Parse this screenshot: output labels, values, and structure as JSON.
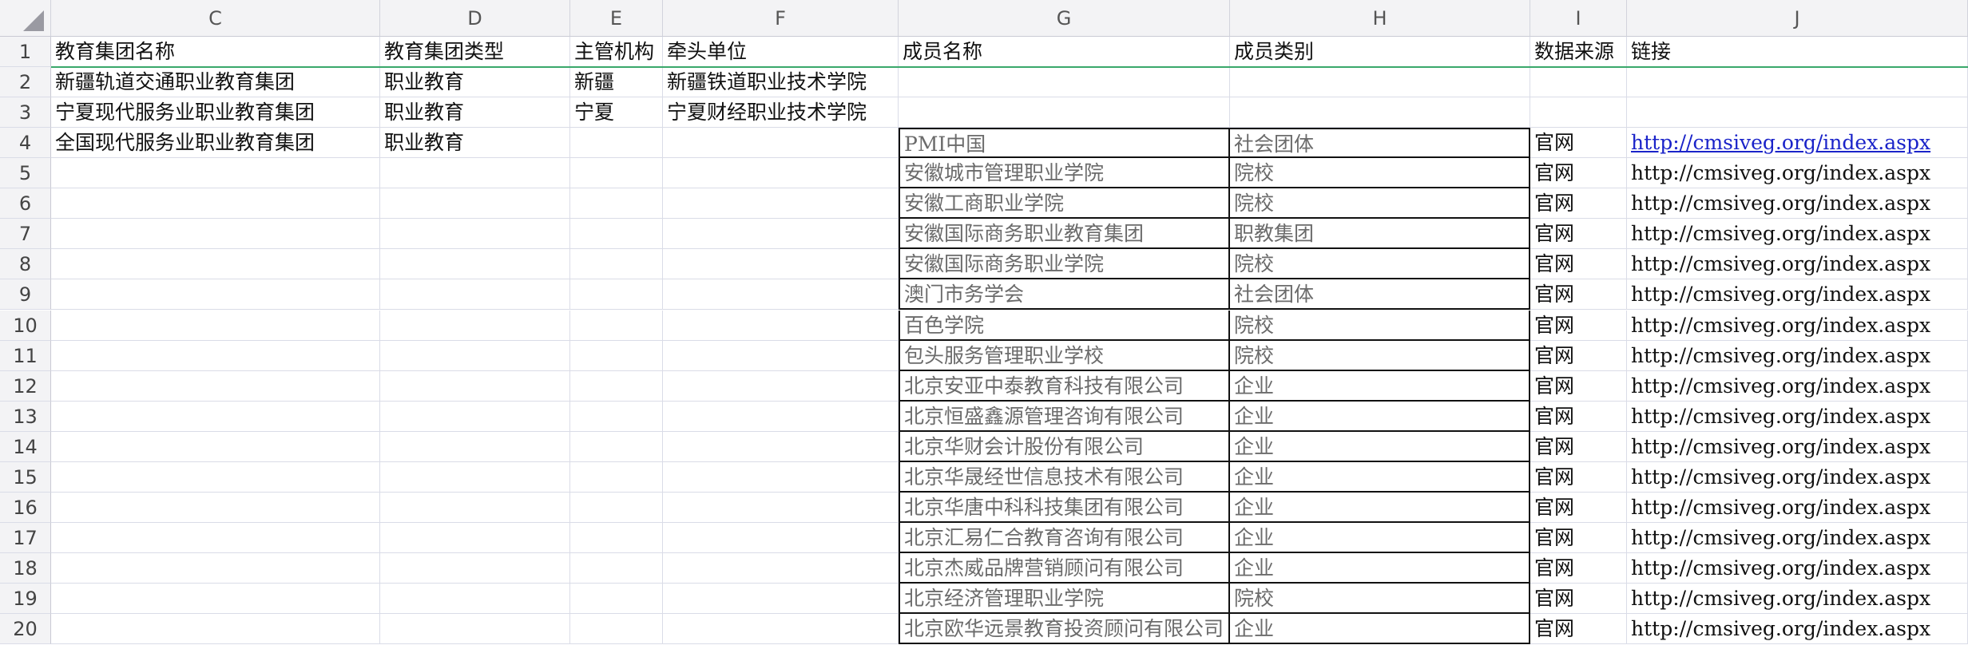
{
  "columns": [
    "C",
    "D",
    "E",
    "F",
    "G",
    "H",
    "I",
    "J"
  ],
  "rows": [
    {
      "num": "1",
      "cells": [
        "教育集团名称",
        "教育集团类型",
        "主管机构",
        "牵头单位",
        "成员名称",
        "成员类别",
        "数据来源",
        "链接"
      ]
    },
    {
      "num": "2",
      "cells": [
        "新疆轨道交通职业教育集团",
        "职业教育",
        "新疆",
        "新疆铁道职业技术学院",
        "",
        "",
        "",
        ""
      ]
    },
    {
      "num": "3",
      "cells": [
        "宁夏现代服务业职业教育集团",
        "职业教育",
        "宁夏",
        "宁夏财经职业技术学院",
        "",
        "",
        "",
        ""
      ]
    },
    {
      "num": "4",
      "cells": [
        "全国现代服务业职业教育集团",
        "职业教育",
        "",
        "",
        "PMI中国",
        "社会团体",
        "官网",
        "http://cmsiveg.org/index.aspx"
      ]
    },
    {
      "num": "5",
      "cells": [
        "",
        "",
        "",
        "",
        "安徽城市管理职业学院",
        "院校",
        "官网",
        "http://cmsiveg.org/index.aspx"
      ]
    },
    {
      "num": "6",
      "cells": [
        "",
        "",
        "",
        "",
        "安徽工商职业学院",
        "院校",
        "官网",
        "http://cmsiveg.org/index.aspx"
      ]
    },
    {
      "num": "7",
      "cells": [
        "",
        "",
        "",
        "",
        "安徽国际商务职业教育集团",
        "职教集团",
        "官网",
        "http://cmsiveg.org/index.aspx"
      ]
    },
    {
      "num": "8",
      "cells": [
        "",
        "",
        "",
        "",
        "安徽国际商务职业学院",
        "院校",
        "官网",
        "http://cmsiveg.org/index.aspx"
      ]
    },
    {
      "num": "9",
      "cells": [
        "",
        "",
        "",
        "",
        "澳门市务学会",
        "社会团体",
        "官网",
        "http://cmsiveg.org/index.aspx"
      ]
    },
    {
      "num": "10",
      "cells": [
        "",
        "",
        "",
        "",
        "百色学院",
        "院校",
        "官网",
        "http://cmsiveg.org/index.aspx"
      ]
    },
    {
      "num": "11",
      "cells": [
        "",
        "",
        "",
        "",
        "包头服务管理职业学校",
        "院校",
        "官网",
        "http://cmsiveg.org/index.aspx"
      ]
    },
    {
      "num": "12",
      "cells": [
        "",
        "",
        "",
        "",
        "北京安亚中泰教育科技有限公司",
        "企业",
        "官网",
        "http://cmsiveg.org/index.aspx"
      ]
    },
    {
      "num": "13",
      "cells": [
        "",
        "",
        "",
        "",
        "北京恒盛鑫源管理咨询有限公司",
        "企业",
        "官网",
        "http://cmsiveg.org/index.aspx"
      ]
    },
    {
      "num": "14",
      "cells": [
        "",
        "",
        "",
        "",
        "北京华财会计股份有限公司",
        "企业",
        "官网",
        "http://cmsiveg.org/index.aspx"
      ]
    },
    {
      "num": "15",
      "cells": [
        "",
        "",
        "",
        "",
        "北京华晟经世信息技术有限公司",
        "企业",
        "官网",
        "http://cmsiveg.org/index.aspx"
      ]
    },
    {
      "num": "16",
      "cells": [
        "",
        "",
        "",
        "",
        "北京华唐中科科技集团有限公司",
        "企业",
        "官网",
        "http://cmsiveg.org/index.aspx"
      ]
    },
    {
      "num": "17",
      "cells": [
        "",
        "",
        "",
        "",
        "北京汇易仁合教育咨询有限公司",
        "企业",
        "官网",
        "http://cmsiveg.org/index.aspx"
      ]
    },
    {
      "num": "18",
      "cells": [
        "",
        "",
        "",
        "",
        "北京杰威品牌营销顾问有限公司",
        "企业",
        "官网",
        "http://cmsiveg.org/index.aspx"
      ]
    },
    {
      "num": "19",
      "cells": [
        "",
        "",
        "",
        "",
        "北京经济管理职业学院",
        "院校",
        "官网",
        "http://cmsiveg.org/index.aspx"
      ]
    },
    {
      "num": "20",
      "cells": [
        "",
        "",
        "",
        "",
        "北京欧华远景教育投资顾问有限公司",
        "企业",
        "官网",
        "http://cmsiveg.org/index.aspx"
      ]
    }
  ],
  "colors": {
    "link": "#1a23c9",
    "frozen_line": "#3aa86b",
    "header_bg": "#f3f3f5",
    "grid": "#dadce7"
  },
  "icons": {
    "corner": "select-all-triangle-icon"
  }
}
